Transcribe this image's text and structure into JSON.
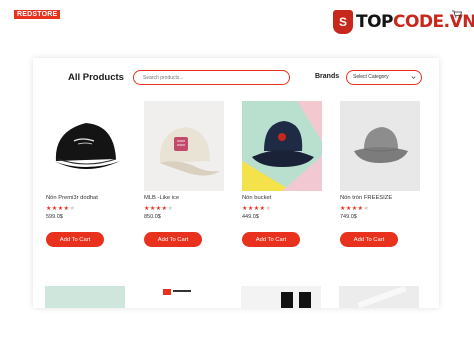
{
  "header": {
    "logo_text": "REDSTORE",
    "top_links": [
      "",
      "",
      ""
    ]
  },
  "watermark": {
    "shield_letter": "S",
    "text_main": "TOP",
    "text_accent": "CODE.VN"
  },
  "toolbar": {
    "title": "All Products",
    "search_placeholder": "Search products...",
    "brands_label": "Brands",
    "brand_select_value": "Select Category"
  },
  "products": [
    {
      "name": "Nón Premi3r dodhat",
      "price": "599.0$",
      "rating": 4,
      "button": "Add To Cart"
    },
    {
      "name": "MLB -Like ice",
      "price": "850.0$",
      "rating": 4,
      "button": "Add To Cart"
    },
    {
      "name": "Nón bucket",
      "price": "449.0$",
      "rating": 4,
      "button": "Add To Cart"
    },
    {
      "name": "Nón tròn FREESIZE",
      "price": "749.0$",
      "rating": 4,
      "button": "Add To Cart"
    }
  ],
  "colors": {
    "accent": "#e8321d",
    "watermark_red": "#c8271c"
  }
}
